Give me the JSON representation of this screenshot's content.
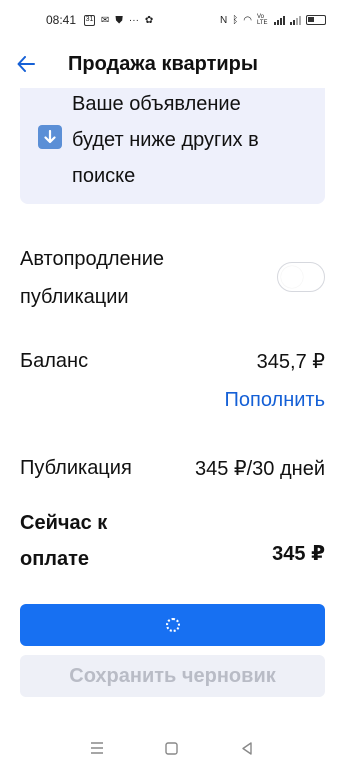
{
  "status_bar": {
    "time": "08:41",
    "calendar_day": "31",
    "network_label": "Vo LTE"
  },
  "app_bar": {
    "title": "Продажа квартиры"
  },
  "info_card": {
    "line1": "Ваше объявление",
    "line2": "будет ниже других в",
    "line3": "поиске",
    "icon": "down-arrow-emoji-icon"
  },
  "autorenew": {
    "label_line1": "Автопродление",
    "label_line2": "публикации",
    "enabled": false
  },
  "balance": {
    "label": "Баланс",
    "value": "345,7 ₽",
    "topup_label": "Пополнить"
  },
  "publication": {
    "label": "Публикация",
    "price": "345 ₽/30 дней"
  },
  "payment": {
    "label_line1": "Сейчас к",
    "label_line2": "оплате",
    "value": "345 ₽"
  },
  "buttons": {
    "primary_state": "loading",
    "save_draft_label": "Сохранить черновик"
  },
  "colors": {
    "accent": "#1770f2",
    "link": "#1560d6",
    "info_bg": "#eef0fb",
    "disabled_bg": "#eef0f7",
    "disabled_text": "#b9bcc6"
  }
}
